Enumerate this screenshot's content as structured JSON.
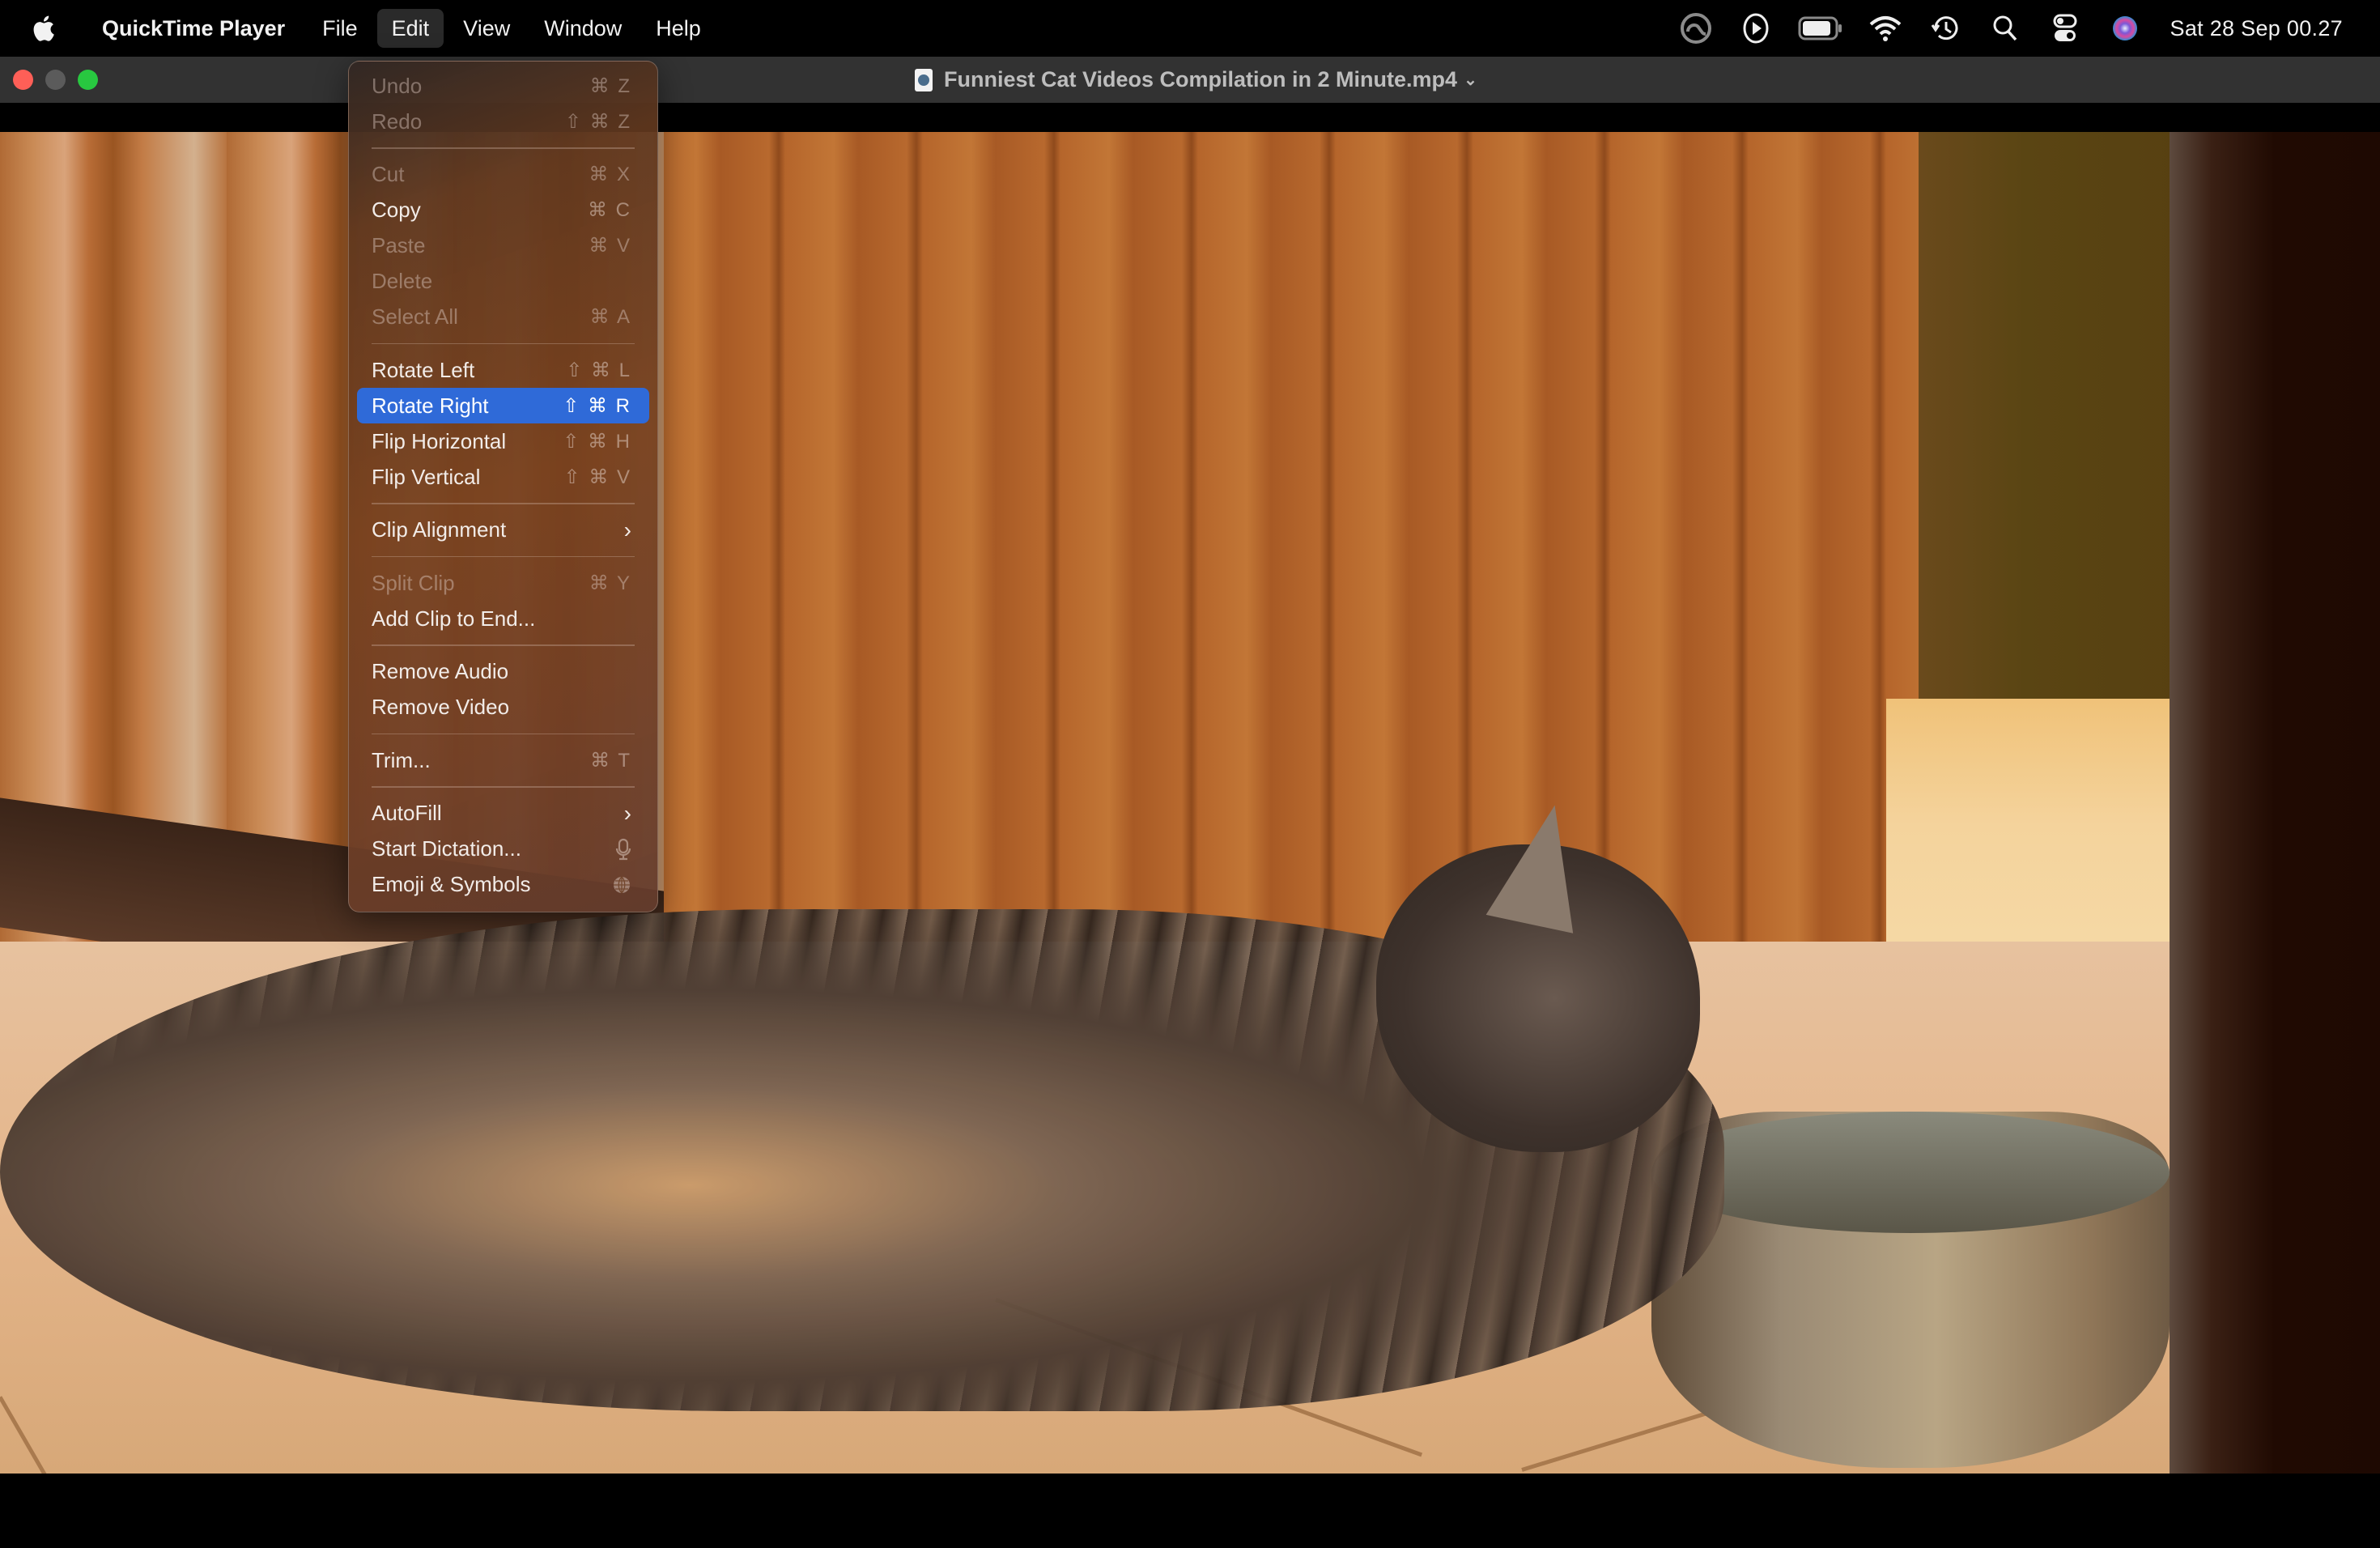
{
  "menubar": {
    "apple_icon": "apple-logo-icon",
    "app_name": "QuickTime Player",
    "menus": [
      {
        "label": "File",
        "active": false
      },
      {
        "label": "Edit",
        "active": true
      },
      {
        "label": "View",
        "active": false
      },
      {
        "label": "Window",
        "active": false
      },
      {
        "label": "Help",
        "active": false
      }
    ],
    "status_icons": [
      "creative-cloud-icon",
      "play-circle-icon",
      "battery-icon",
      "wifi-icon",
      "time-machine-icon",
      "spotlight-search-icon",
      "control-center-icon",
      "siri-icon"
    ],
    "clock": "Sat 28 Sep  00.27"
  },
  "window": {
    "title": "Funniest Cat Videos Compilation in 2 Minute.mp4",
    "title_chevron": "⌄"
  },
  "edit_menu": {
    "groups": [
      [
        {
          "label": "Undo",
          "shortcut": "⌘ Z",
          "enabled": false
        },
        {
          "label": "Redo",
          "shortcut": "⇧ ⌘ Z",
          "enabled": false
        }
      ],
      [
        {
          "label": "Cut",
          "shortcut": "⌘ X",
          "enabled": false
        },
        {
          "label": "Copy",
          "shortcut": "⌘ C",
          "enabled": true
        },
        {
          "label": "Paste",
          "shortcut": "⌘ V",
          "enabled": false
        },
        {
          "label": "Delete",
          "shortcut": "",
          "enabled": false
        },
        {
          "label": "Select All",
          "shortcut": "⌘ A",
          "enabled": false
        }
      ],
      [
        {
          "label": "Rotate Left",
          "shortcut": "⇧ ⌘ L",
          "enabled": true
        },
        {
          "label": "Rotate Right",
          "shortcut": "⇧ ⌘ R",
          "enabled": true,
          "highlighted": true
        },
        {
          "label": "Flip Horizontal",
          "shortcut": "⇧ ⌘ H",
          "enabled": true
        },
        {
          "label": "Flip Vertical",
          "shortcut": "⇧ ⌘ V",
          "enabled": true
        }
      ],
      [
        {
          "label": "Clip Alignment",
          "submenu": true,
          "enabled": true
        }
      ],
      [
        {
          "label": "Split Clip",
          "shortcut": "⌘ Y",
          "enabled": false
        },
        {
          "label": "Add Clip to End...",
          "shortcut": "",
          "enabled": true
        }
      ],
      [
        {
          "label": "Remove Audio",
          "shortcut": "",
          "enabled": true
        },
        {
          "label": "Remove Video",
          "shortcut": "",
          "enabled": true
        }
      ],
      [
        {
          "label": "Trim...",
          "shortcut": "⌘ T",
          "enabled": true
        }
      ],
      [
        {
          "label": "AutoFill",
          "submenu": true,
          "enabled": true
        },
        {
          "label": "Start Dictation...",
          "icon": "microphone-icon",
          "enabled": true
        },
        {
          "label": "Emoji & Symbols",
          "icon": "globe-icon",
          "enabled": true
        }
      ]
    ]
  },
  "video": {
    "description": "Tabby cat lying on tiled kitchen floor next to a stainless steel bowl"
  },
  "colors": {
    "highlight": "#2f6ad8",
    "close": "#fe5f57",
    "minimize_inactive": "#5b5b5b",
    "zoom": "#28c840"
  }
}
